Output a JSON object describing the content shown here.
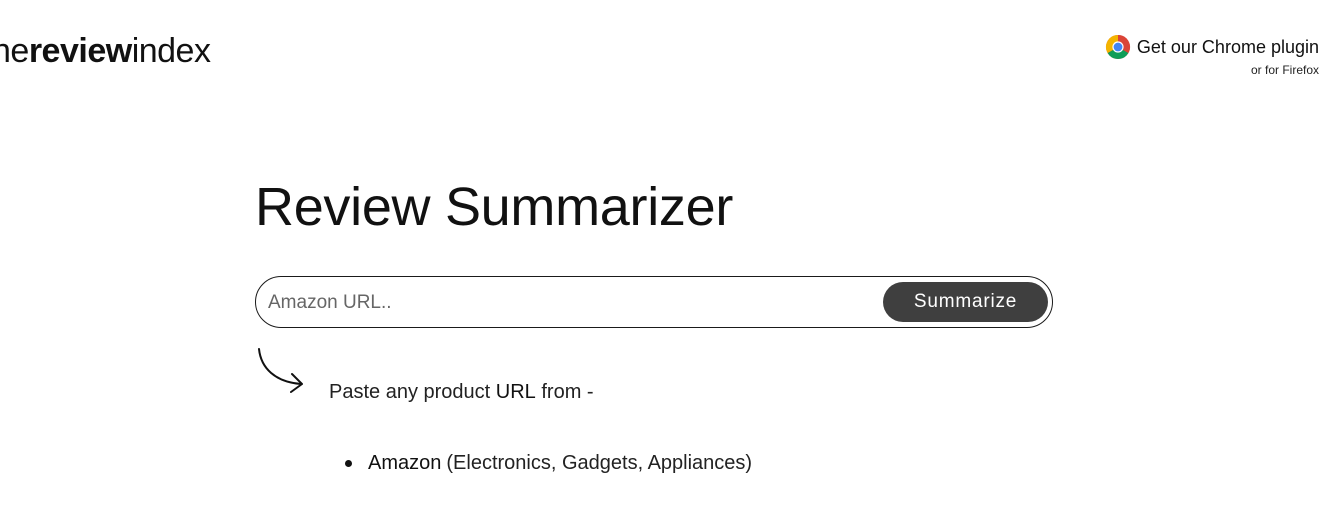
{
  "header": {
    "logo": {
      "part1": "he",
      "part2": "review",
      "part3": "index"
    },
    "plugin": {
      "icon": "chrome-icon",
      "main_label": "Get our Chrome plugin",
      "sub_label": "or for Firefox"
    }
  },
  "main": {
    "title": "Review Summarizer",
    "search": {
      "placeholder": "Amazon URL..",
      "value": "",
      "button_label": "Summarize"
    },
    "instructions": {
      "arrow_icon": "curved-arrow-icon",
      "prefix": "Paste any product ",
      "emphasis": "URL",
      "suffix": " from -"
    },
    "sources": [
      {
        "name": "Amazon",
        "detail": "(Electronics, Gadgets, Appliances)"
      }
    ]
  },
  "colors": {
    "button_bg": "#3f3f3f",
    "button_text": "#ffffff",
    "border": "#1a1a1a",
    "text": "#111111"
  }
}
